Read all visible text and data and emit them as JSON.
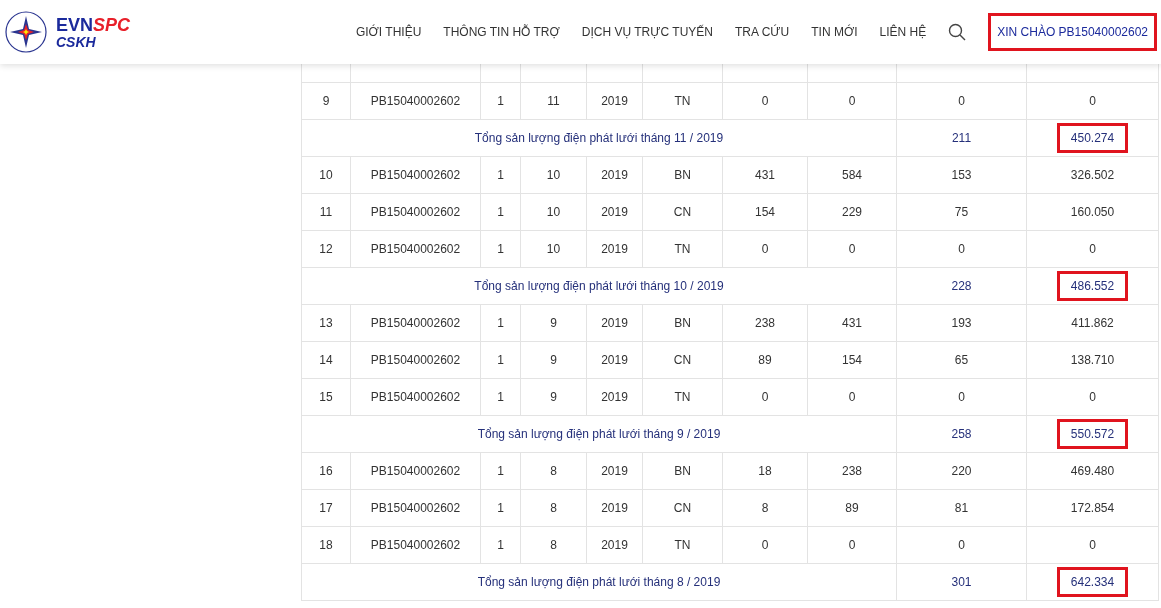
{
  "header": {
    "logo": {
      "brand_a": "EVN",
      "brand_b": "SPC",
      "sub": "CSKH"
    },
    "nav": [
      {
        "label": "GIỚI THIỆU"
      },
      {
        "label": "THÔNG TIN HỖ TRỢ"
      },
      {
        "label": "DỊCH VỤ TRỰC TUYẾN"
      },
      {
        "label": "TRA CỨU"
      },
      {
        "label": "TIN MỚI"
      },
      {
        "label": "LIÊN HỆ"
      }
    ],
    "greeting": {
      "label": "XIN CHÀO PB15040002602",
      "highlighted": true
    }
  },
  "table": {
    "groups": [
      {
        "rows": [
          [
            "9",
            "PB15040002602",
            "1",
            "11",
            "2019",
            "TN",
            "0",
            "0",
            "0",
            "0"
          ]
        ],
        "summary": {
          "label": "Tổng sản lượng điện phát lưới tháng 11 / 2019",
          "count": "211",
          "total": "450.274",
          "highlighted": true
        }
      },
      {
        "rows": [
          [
            "10",
            "PB15040002602",
            "1",
            "10",
            "2019",
            "BN",
            "431",
            "584",
            "153",
            "326.502"
          ],
          [
            "11",
            "PB15040002602",
            "1",
            "10",
            "2019",
            "CN",
            "154",
            "229",
            "75",
            "160.050"
          ],
          [
            "12",
            "PB15040002602",
            "1",
            "10",
            "2019",
            "TN",
            "0",
            "0",
            "0",
            "0"
          ]
        ],
        "summary": {
          "label": "Tổng sản lượng điện phát lưới tháng 10 / 2019",
          "count": "228",
          "total": "486.552",
          "highlighted": true
        }
      },
      {
        "rows": [
          [
            "13",
            "PB15040002602",
            "1",
            "9",
            "2019",
            "BN",
            "238",
            "431",
            "193",
            "411.862"
          ],
          [
            "14",
            "PB15040002602",
            "1",
            "9",
            "2019",
            "CN",
            "89",
            "154",
            "65",
            "138.710"
          ],
          [
            "15",
            "PB15040002602",
            "1",
            "9",
            "2019",
            "TN",
            "0",
            "0",
            "0",
            "0"
          ]
        ],
        "summary": {
          "label": "Tổng sản lượng điện phát lưới tháng 9 / 2019",
          "count": "258",
          "total": "550.572",
          "highlighted": true
        }
      },
      {
        "rows": [
          [
            "16",
            "PB15040002602",
            "1",
            "8",
            "2019",
            "BN",
            "18",
            "238",
            "220",
            "469.480"
          ],
          [
            "17",
            "PB15040002602",
            "1",
            "8",
            "2019",
            "CN",
            "8",
            "89",
            "81",
            "172.854"
          ],
          [
            "18",
            "PB15040002602",
            "1",
            "8",
            "2019",
            "TN",
            "0",
            "0",
            "0",
            "0"
          ]
        ],
        "summary": {
          "label": "Tổng sản lượng điện phát lưới tháng 8 / 2019",
          "count": "301",
          "total": "642.334",
          "highlighted": true
        }
      }
    ]
  }
}
